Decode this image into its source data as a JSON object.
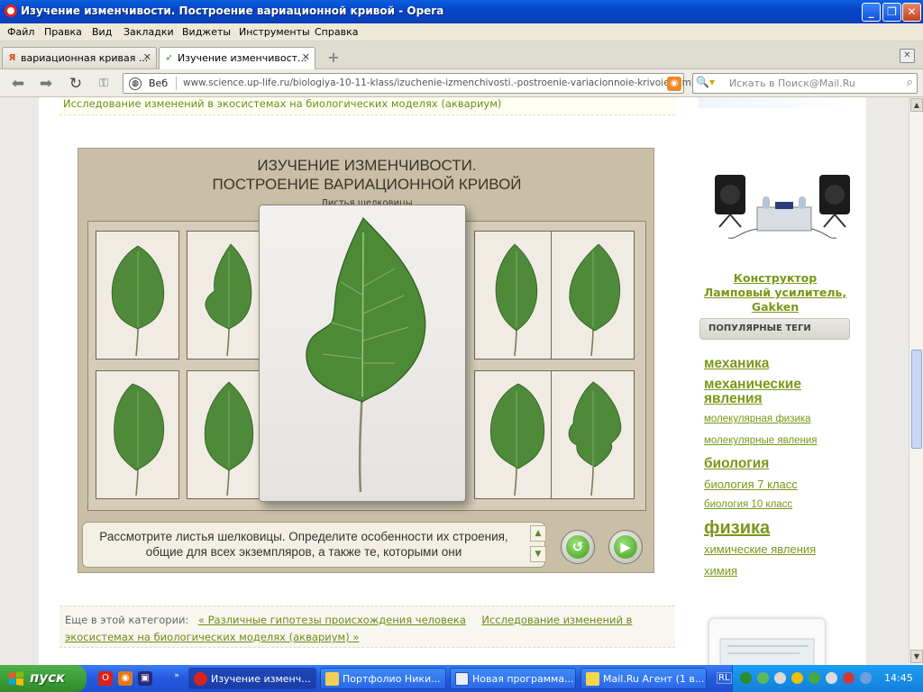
{
  "window": {
    "title": "Изучение изменчивости. Построение вариационной кривой - Opera"
  },
  "menu": [
    "Файл",
    "Правка",
    "Вид",
    "Закладки",
    "Виджеты",
    "Инструменты",
    "Справка"
  ],
  "tabs": [
    {
      "label": "вариационная кривая ...",
      "favicon": "yandex-icon",
      "active": false
    },
    {
      "label": "Изучение изменчивост...",
      "favicon": "uplife-icon",
      "active": true
    }
  ],
  "addressbar": {
    "web_label": "Веб",
    "url": "www.science.up-life.ru/biologiya-10-11-klass/izuchenie-izmenchivosti.-postroenie-variacionnoie-krivoie.html",
    "search_placeholder": "Искать в Поиск@Mail.Ru"
  },
  "page": {
    "top_link": "Исследование изменений в экосистемах на биологических моделях (аквариум)",
    "app": {
      "title_line1": "ИЗУЧЕНИЕ ИЗМЕНЧИВОСТИ.",
      "title_line2": "ПОСТРОЕНИЕ ВАРИАЦИОННОЙ КРИВОЙ",
      "subtitle": "Листья шелковицы",
      "instruction": "Рассмотрите листья шелковицы. Определите особенности их строения, общие для всех экземпляров, а также те, которыми они",
      "leaf_color": "#4f8a3a"
    },
    "more_category": {
      "label": "Еще в этой категории:",
      "link1": "« Различные гипотезы происхождения человека",
      "link2": "Исследование изменений в экосистемах на биологических моделях (аквариум) »"
    },
    "sidebar": {
      "product_title": "Конструктор Ламповый усилитель, Gakken",
      "tags_heading": "ПОПУЛЯРНЫЕ ТЕГИ",
      "tags": [
        {
          "label": "механика",
          "size": "large"
        },
        {
          "label": "механические явления",
          "size": "large"
        },
        {
          "label": "молекулярная физика",
          "size": "small"
        },
        {
          "label": "молекулярные явления",
          "size": "small"
        },
        {
          "label": "биология",
          "size": "large"
        },
        {
          "label": "биология 7 класс",
          "size": "medium"
        },
        {
          "label": "биология 10 класс",
          "size": "small"
        },
        {
          "label": "физика",
          "size": "xlarge"
        },
        {
          "label": "химические явления",
          "size": "medium"
        },
        {
          "label": "химия",
          "size": "medium"
        }
      ],
      "accent_color": "#7a9718"
    }
  },
  "taskbar": {
    "start_label": "пуск",
    "tasks": [
      {
        "label": "Изучение изменч...",
        "icon": "opera-icon",
        "active": true
      },
      {
        "label": "Портфолио Ники...",
        "icon": "folder-icon",
        "active": false
      },
      {
        "label": "Новая программа...",
        "icon": "document-icon",
        "active": false
      },
      {
        "label": "Mail.Ru Агент (1 в...",
        "icon": "mail-agent-icon",
        "active": false
      }
    ],
    "lang": "RL",
    "clock": "14:45"
  }
}
